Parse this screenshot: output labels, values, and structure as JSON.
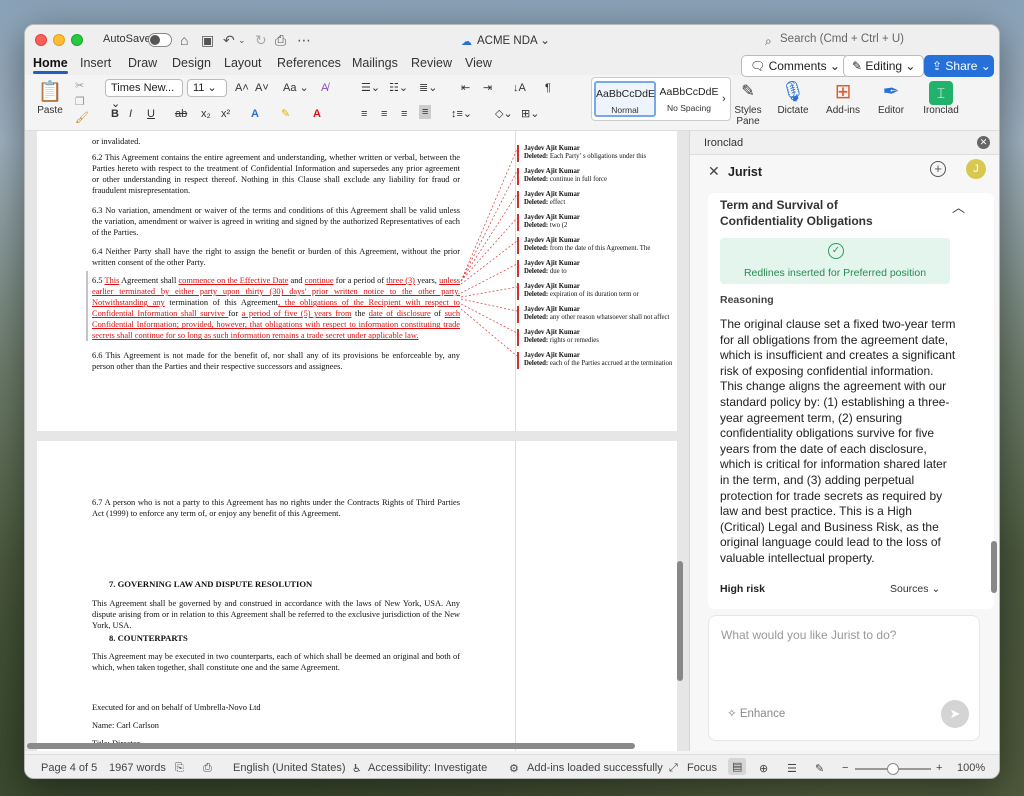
{
  "titlebar": {
    "autosave_label": "AutoSave",
    "doc_title": "ACME NDA",
    "search_placeholder": "Search (Cmd + Ctrl + U)"
  },
  "tabs": [
    "Home",
    "Insert",
    "Draw",
    "Design",
    "Layout",
    "References",
    "Mailings",
    "Review",
    "View"
  ],
  "top_actions": {
    "comments": "Comments",
    "editing": "Editing",
    "share": "Share"
  },
  "ribbon": {
    "paste": "Paste",
    "font": "Times New...",
    "size": "11",
    "style_normal_sample": "AaBbCcDdE",
    "style_normal": "Normal",
    "style_nospacing_sample": "AaBbCcDdE",
    "style_nospacing": "No Spacing",
    "styles_pane_1": "Styles",
    "styles_pane_2": "Pane",
    "dictate": "Dictate",
    "addins": "Add-ins",
    "editor": "Editor",
    "ironclad": "Ironclad"
  },
  "doc": {
    "p_invalidated": "or invalidated.",
    "p62": "6.2 This Agreement contains the entire agreement and understanding, whether written or verbal, between the Parties hereto with respect to the treatment of Confidential Information and supersedes any prior agreement or other understanding in respect thereof. Nothing in this Clause shall exclude any liability for fraud or fraudulent misrepresentation.",
    "p63": "6.3 No variation, amendment or waiver of the terms and conditions of this Agreement shall be valid unless the variation, amendment or waiver is agreed in writing and signed by the authorized Representatives of each of the Parties.",
    "p64": "6.4 Neither Party shall have the right to assign the benefit or burden of this Agreement, without the prior written consent of the other Party.",
    "p65": {
      "a": "6.5 ",
      "b": "This",
      "c": " Agreement shall ",
      "d": "commence on the Effective Date",
      "e": " and ",
      "f": "continue",
      "g": " for a period of ",
      "h": "three (3)",
      "i": " years, ",
      "j": "unless earlier terminated by either party upon thirty (30) days' prior written notice to the other party. Notwithstanding any",
      "k": " termination of this Agreement",
      "l": ", the obligations of the ",
      "m": "Recipient with respect to Confidential Information shall survive ",
      "n": "for ",
      "o": "a period of five (5) years from",
      "p": " the ",
      "q": "date of disclosure",
      "r": " of ",
      "s": "such Confidential Information; provided, however, that obligations with respect to information constituting trade secrets shall continue for so long as such information remains a trade secret under applicable law."
    },
    "p66": "6.6 This Agreement is not made for the benefit of, nor shall any of its provisions be enforceable by, any person other than the Parties and their respective successors and assignees.",
    "p67": "6.7 A person who is not a party to this Agreement has no rights under the Contracts Rights of Third Parties Act (1999) to enforce any term of, or enjoy any benefit of this Agreement.",
    "h7": "7. GOVERNING LAW AND DISPUTE RESOLUTION",
    "p7": "This Agreement shall be governed by and construed in accordance with the laws of New York, USA. Any dispute arising from or in relation to this Agreement shall be referred to the exclusive jurisdiction of the New York, USA.",
    "h8": "8. COUNTERPARTS",
    "p8": "This Agreement may be executed in two counterparts, each of which shall be deemed an original and both of which, when taken together, shall constitute one and the same Agreement.",
    "executed": "Executed for and on behalf of Umbrella-Novo Ltd",
    "name": "Name: Carl Carlson",
    "title": "Title: Director"
  },
  "comments": [
    {
      "author": "Jaydev Ajit Kumar",
      "label": "Deleted:",
      "text": "Each Party’ s obligations under this"
    },
    {
      "author": "Jaydev Ajit Kumar",
      "label": "Deleted:",
      "text": "continue in full force"
    },
    {
      "author": "Jaydev Ajit Kumar",
      "label": "Deleted:",
      "text": "effect"
    },
    {
      "author": "Jaydev Ajit Kumar",
      "label": "Deleted:",
      "text": "two (2"
    },
    {
      "author": "Jaydev Ajit Kumar",
      "label": "Deleted:",
      "text": "from the date of this Agreement. The"
    },
    {
      "author": "Jaydev Ajit Kumar",
      "label": "Deleted:",
      "text": "due to"
    },
    {
      "author": "Jaydev Ajit Kumar",
      "label": "Deleted:",
      "text": "expiration of its duration term or"
    },
    {
      "author": "Jaydev Ajit Kumar",
      "label": "Deleted:",
      "text": "any other reason whatsoever shall not affect"
    },
    {
      "author": "Jaydev Ajit Kumar",
      "label": "Deleted:",
      "text": "rights or remedies"
    },
    {
      "author": "Jaydev Ajit Kumar",
      "label": "Deleted:",
      "text": "each of the Parties accrued at the termination"
    }
  ],
  "panel": {
    "title": "Ironclad",
    "jurist": "Jurist",
    "avatar": "J",
    "clause_title": "Term and Survival of Confidentiality Obligations",
    "success_text": "Redlines inserted for Preferred position",
    "reasoning_label": "Reasoning",
    "reasoning": "The original clause set a fixed two-year term for all obligations from the agreement date, which is insufficient and creates a significant risk of exposing confidential information. This change aligns the agreement with our standard policy by: (1) establishing a three-year agreement term, (2) ensuring confidentiality obligations survive for five years from the date of each disclosure, which is critical for information shared later in the term, and (3) adding perpetual protection for trade secrets as required by law and best practice. This is a High (Critical) Legal and Business Risk, as the original language could lead to the loss of valuable intellectual property.",
    "risk": "High risk",
    "sources": "Sources",
    "input_placeholder": "What would you like Jurist to do?",
    "enhance": "Enhance"
  },
  "status": {
    "page": "Page 4 of 5",
    "words": "1967 words",
    "language": "English (United States)",
    "accessibility": "Accessibility: Investigate",
    "addins": "Add-ins loaded successfully",
    "focus": "Focus",
    "zoom_minus": "−",
    "zoom_plus": "+",
    "zoom": "100%"
  },
  "colors": {
    "accent": "#2670d9",
    "redline": "#d11111",
    "ironclad_green": "#21b26b",
    "success_bg": "#e3f5ec"
  }
}
